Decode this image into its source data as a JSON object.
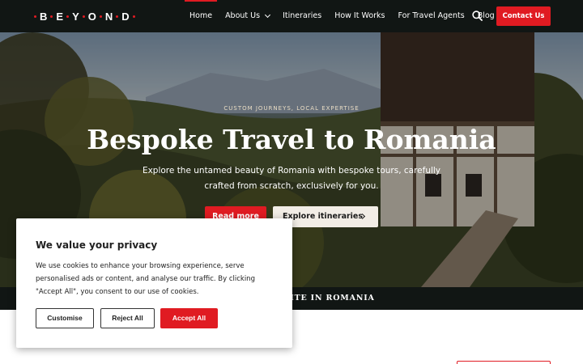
{
  "brand": {
    "letters": [
      "B",
      "E",
      "Y",
      "O",
      "N",
      "D"
    ],
    "accent_color": "#e01b22"
  },
  "nav": {
    "items": [
      {
        "label": "Home",
        "active": true
      },
      {
        "label": "About Us",
        "has_dropdown": true
      },
      {
        "label": "Itineraries"
      },
      {
        "label": "How It Works"
      },
      {
        "label": "For Travel Agents"
      },
      {
        "label": "Blog"
      }
    ],
    "search_icon": "search-icon",
    "contact_label": "Contact Us"
  },
  "hero": {
    "tagline": "CUSTOM JOURNEYS, LOCAL EXPERTISE",
    "title": "Bespoke Travel to Romania",
    "subtitle": "Explore the untamed beauty of Romania with bespoke tours, carefully crafted from scratch, exclusively for you.",
    "primary_button": "Read more",
    "secondary_button": "Explore itineraries"
  },
  "strip": {
    "text": "-SITE IN ROMANIA"
  },
  "cookie": {
    "title": "We value your privacy",
    "body": "We use cookies to enhance your browsing experience, serve personalised ads or content, and analyse our traffic. By clicking \"Accept All\", you consent to our use of cookies.",
    "customise_label": "Customise",
    "reject_label": "Reject All",
    "accept_label": "Accept All"
  }
}
